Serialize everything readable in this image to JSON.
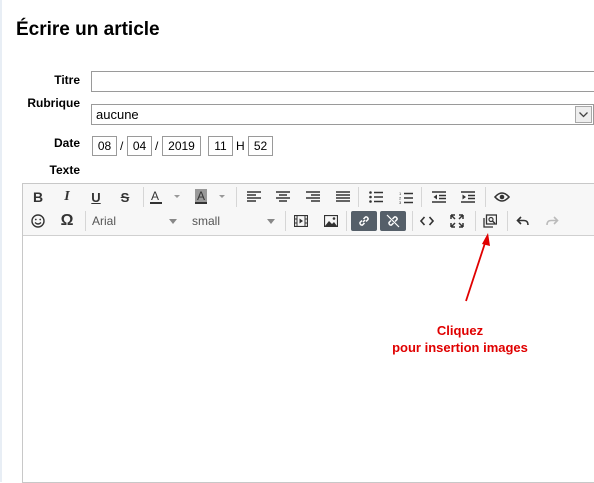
{
  "page": {
    "title": "Écrire un article"
  },
  "form": {
    "titre_label": "Titre",
    "titre_value": "",
    "rubrique_label": "Rubrique",
    "rubrique_value": "aucune",
    "date_label": "Date",
    "day": "08",
    "month": "04",
    "year": "2019",
    "hour": "11",
    "minute": "52",
    "date_sep": "/",
    "hour_sep": "H",
    "texte_label": "Texte"
  },
  "toolbar": {
    "font_value": "Arial",
    "size_value": "small",
    "icons": [
      "bold-icon",
      "italic-icon",
      "underline-icon",
      "strikethrough-icon",
      "text-color-icon",
      "background-color-icon",
      "align-left-icon",
      "align-center-icon",
      "align-right-icon",
      "justify-icon",
      "bullet-list-icon",
      "numbered-list-icon",
      "outdent-icon",
      "indent-icon",
      "preview-icon",
      "emoticon-icon",
      "special-char-icon",
      "media-icon",
      "image-icon",
      "link-icon",
      "unlink-icon",
      "source-code-icon",
      "fullscreen-icon",
      "image-manager-icon",
      "undo-icon",
      "redo-icon"
    ]
  },
  "annotation": {
    "line1": "Cliquez",
    "line2": "pour insertion images",
    "color": "#e00000"
  }
}
